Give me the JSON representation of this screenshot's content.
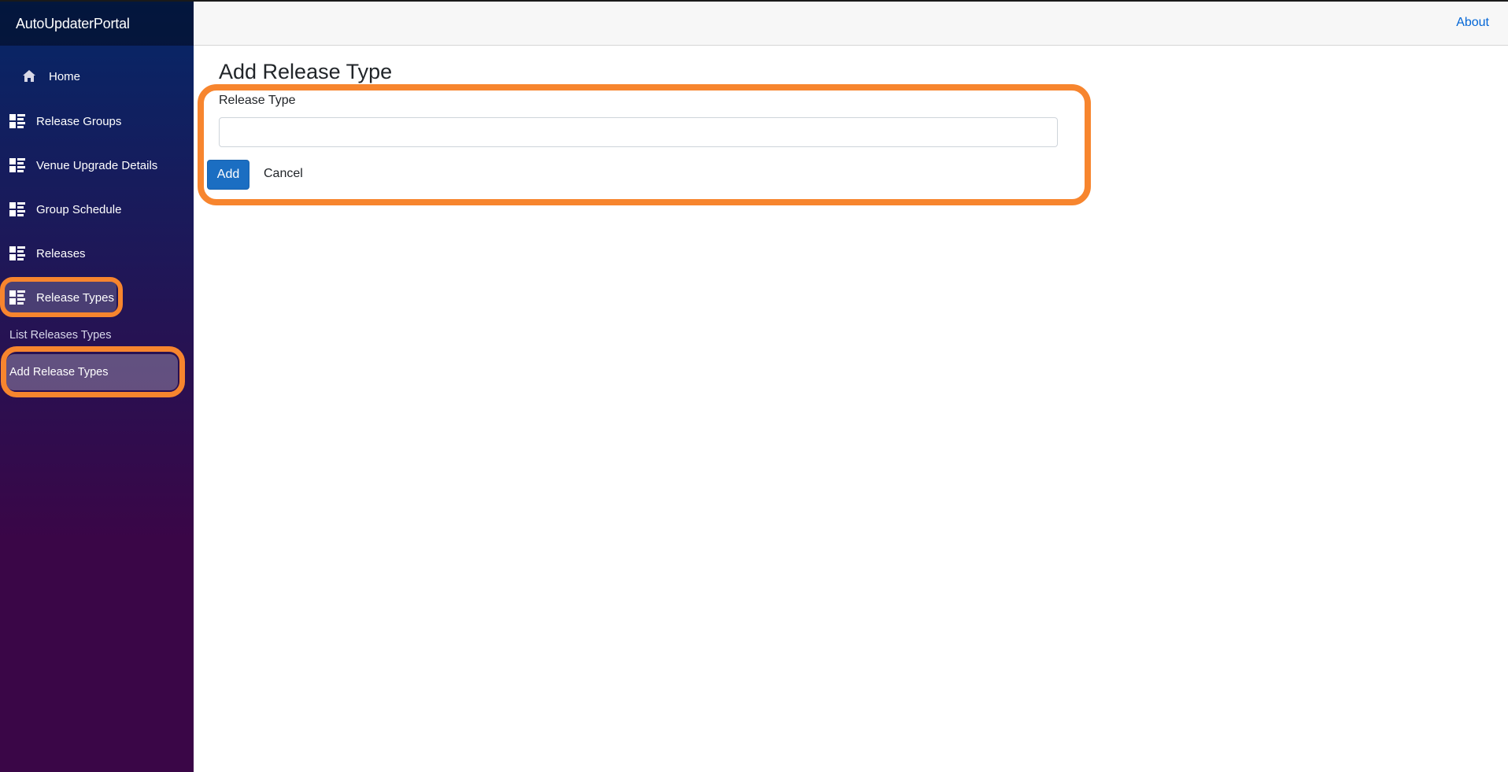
{
  "brand": "AutoUpdaterPortal",
  "top_nav": {
    "about": "About"
  },
  "sidebar": {
    "items": [
      {
        "label": "Home",
        "icon": "home-icon"
      },
      {
        "label": "Release Groups",
        "icon": "grid-list-icon"
      },
      {
        "label": "Venue Upgrade Details",
        "icon": "grid-list-icon"
      },
      {
        "label": "Group Schedule",
        "icon": "grid-list-icon"
      },
      {
        "label": "Releases",
        "icon": "grid-list-icon"
      },
      {
        "label": "Release Types",
        "icon": "grid-list-icon"
      }
    ],
    "sub_items": [
      {
        "label": "List Releases Types"
      },
      {
        "label": "Add Release Types"
      }
    ]
  },
  "main": {
    "title": "Add Release Type",
    "field_label": "Release Type",
    "field_value": "",
    "add_label": "Add",
    "cancel_label": "Cancel"
  },
  "colors": {
    "highlight_ring": "#f7852e",
    "primary_button": "#1b6ec2",
    "link": "#0366d6",
    "sidebar_top": "#052767",
    "sidebar_bottom": "#3a0647"
  }
}
